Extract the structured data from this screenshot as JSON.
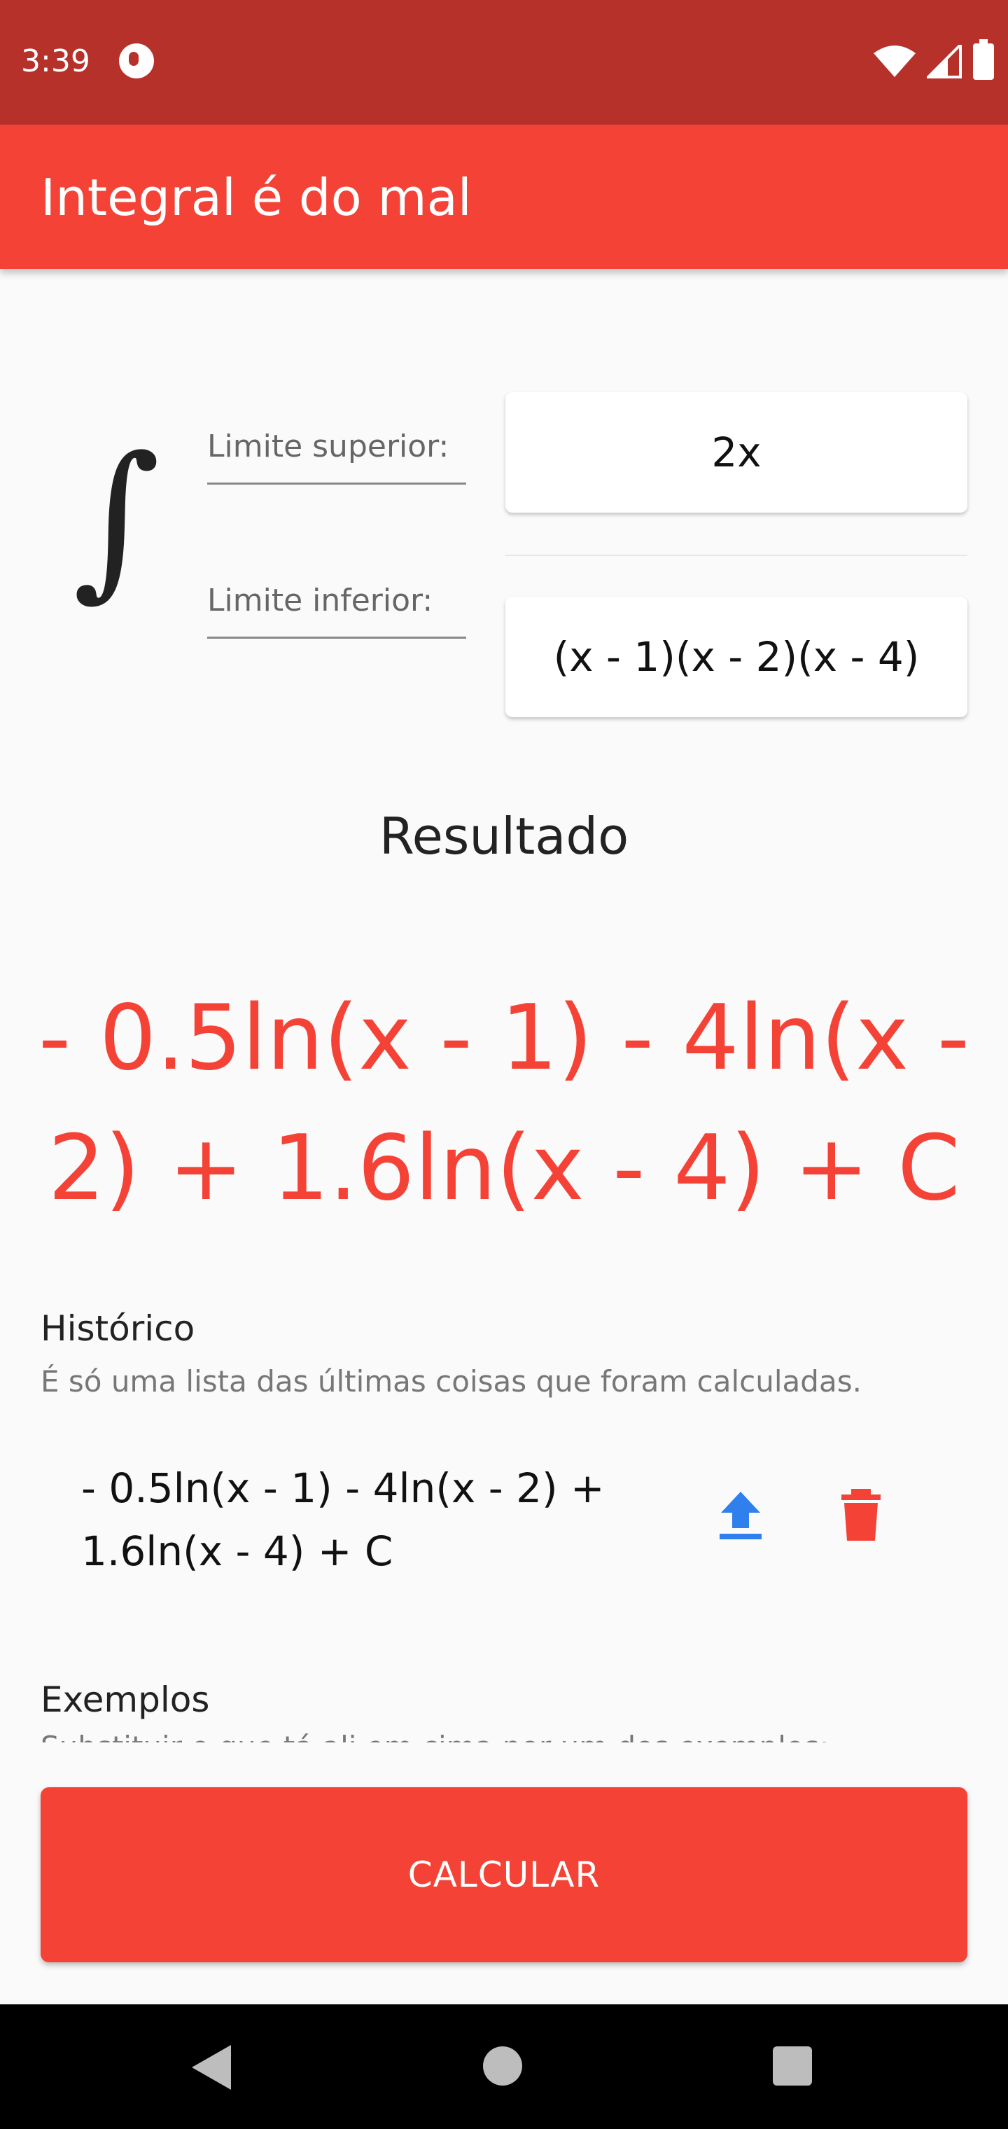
{
  "status_bar": {
    "time": "3:39"
  },
  "app_bar": {
    "title": "Integral é do mal"
  },
  "integral": {
    "symbol": "∫",
    "upper_label": "Limite superior:",
    "lower_label": "Limite inferior:",
    "numerator": "2x",
    "denominator": "(x - 1)(x - 2)(x - 4)"
  },
  "result": {
    "heading": "Resultado",
    "expression": "- 0.5ln(x - 1) - 4ln(x - 2) + 1.6ln(x - 4) + C"
  },
  "history": {
    "title": "Histórico",
    "subtitle": "É só uma lista das últimas coisas que foram calculadas.",
    "items": [
      {
        "expression": "- 0.5ln(x - 1) - 4ln(x - 2) + 1.6ln(x - 4) + C",
        "icons": [
          "upload-icon",
          "delete-icon"
        ]
      }
    ]
  },
  "examples": {
    "title": "Exemplos",
    "subtitle": "Substituir o que tá ali em cima por um dos exemplos:"
  },
  "calc_button": {
    "label": "CALCULAR"
  },
  "colors": {
    "primary": "#f44336",
    "primary_dark": "#b7312b",
    "upload_icon": "#2f80ed",
    "delete_icon": "#f44336"
  }
}
